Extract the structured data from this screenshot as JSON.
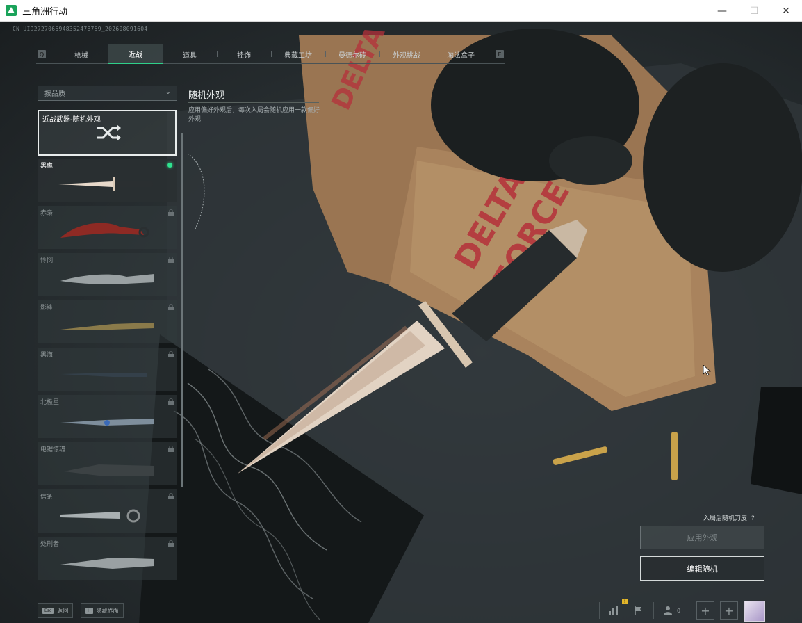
{
  "window": {
    "title": "三角洲行动",
    "controls": [
      "minimize",
      "maximize",
      "close"
    ]
  },
  "uid": "CN UID2727066948352478759_202608091604",
  "tabs": {
    "items": [
      {
        "label": "枪械",
        "active": false
      },
      {
        "label": "近战",
        "active": true
      },
      {
        "label": "道具",
        "active": false
      },
      {
        "label": "挂饰",
        "active": false
      },
      {
        "label": "典藏工坊",
        "active": false
      },
      {
        "label": "曼德尔砖",
        "active": false
      },
      {
        "label": "外观挑战",
        "active": false
      },
      {
        "label": "淘汰盒子",
        "active": false
      }
    ]
  },
  "filter": {
    "label": "按品质",
    "icon": "chevron-down-icon"
  },
  "random_card": {
    "label": "近战武器-随机外观",
    "icon": "shuffle-icon"
  },
  "items": [
    {
      "label": "黑鹰",
      "equipped": true,
      "locked": false
    },
    {
      "label": "赤枭",
      "equipped": false,
      "locked": true
    },
    {
      "label": "怜悯",
      "equipped": false,
      "locked": true
    },
    {
      "label": "影锋",
      "equipped": false,
      "locked": true
    },
    {
      "label": "黑海",
      "equipped": false,
      "locked": true
    },
    {
      "label": "北极星",
      "equipped": false,
      "locked": true
    },
    {
      "label": "电锯惊魂",
      "equipped": false,
      "locked": true
    },
    {
      "label": "信条",
      "equipped": false,
      "locked": true
    },
    {
      "label": "处刑者",
      "equipped": false,
      "locked": true
    }
  ],
  "info": {
    "title": "随机外观",
    "description": "应用偏好外观后，每次入局会随机应用一款偏好外观"
  },
  "actions": {
    "random_skin_label": "入局后随机刀皮",
    "help": "?",
    "apply": "应用外观",
    "edit": "编辑随机"
  },
  "bottom": {
    "back_key": "Esc",
    "back_label": "返回",
    "hide_key": "H",
    "hide_label": "隐藏界面",
    "stats_badge": "!",
    "friends_count": "0"
  },
  "colors": {
    "accent": "#2fd08a",
    "equipped_dot": "#2fe38f",
    "badge": "#e2b62a"
  }
}
